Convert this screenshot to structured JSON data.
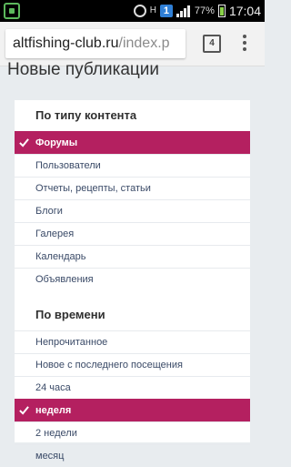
{
  "status": {
    "network_label": "H",
    "badge": "1",
    "battery": "77%",
    "time": "17:04"
  },
  "browser": {
    "url_host": "altfishing-club.ru",
    "url_path": "/index.p",
    "tab_count": "4"
  },
  "page": {
    "title": "Новые публикации"
  },
  "filters": {
    "content_type": {
      "title": "По типу контента",
      "items": [
        {
          "label": "Форумы",
          "selected": true
        },
        {
          "label": "Пользователи",
          "selected": false
        },
        {
          "label": "Отчеты, рецепты, статьи",
          "selected": false
        },
        {
          "label": "Блоги",
          "selected": false
        },
        {
          "label": "Галерея",
          "selected": false
        },
        {
          "label": "Календарь",
          "selected": false
        },
        {
          "label": "Объявления",
          "selected": false
        }
      ]
    },
    "time": {
      "title": "По времени",
      "items": [
        {
          "label": "Непрочитанное",
          "selected": false
        },
        {
          "label": "Новое с последнего посещения",
          "selected": false
        },
        {
          "label": "24 часа",
          "selected": false
        },
        {
          "label": "неделя",
          "selected": true
        },
        {
          "label": "2 недели",
          "selected": false
        },
        {
          "label": "месяц",
          "selected": false
        }
      ]
    }
  },
  "colors": {
    "accent": "#b42060",
    "link": "#3a4a67"
  }
}
